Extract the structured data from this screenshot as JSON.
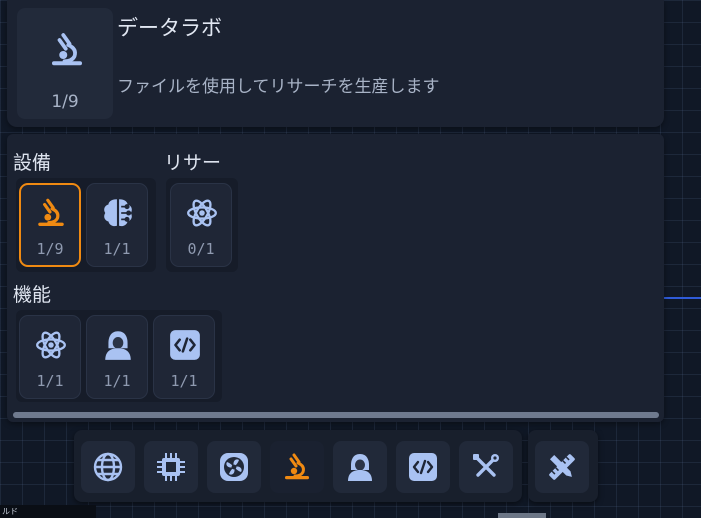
{
  "header": {
    "title": "データラボ",
    "subtitle": "ファイルを使用してリサーチを生産します",
    "icon": "microscope-icon",
    "count": "1/9"
  },
  "sections": {
    "equipment": {
      "label": "設備",
      "slots": [
        {
          "icon": "microscope-icon",
          "count": "1/9",
          "selected": true
        },
        {
          "icon": "brain-circuit-icon",
          "count": "1/1",
          "selected": false
        }
      ]
    },
    "research": {
      "label": "リサー",
      "slots": [
        {
          "icon": "atom-icon",
          "count": "0/1",
          "selected": false
        }
      ]
    },
    "features": {
      "label": "機能",
      "slots": [
        {
          "icon": "atom-icon",
          "count": "1/1"
        },
        {
          "icon": "hooded-user-icon",
          "count": "1/1"
        },
        {
          "icon": "code-icon",
          "count": "1/1"
        }
      ]
    }
  },
  "progress": {
    "fraction": 1.0
  },
  "toolbar": {
    "items": [
      {
        "icon": "globe-icon",
        "active": false
      },
      {
        "icon": "cpu-chip-icon",
        "active": false
      },
      {
        "icon": "fan-icon",
        "active": false
      },
      {
        "icon": "microscope-icon",
        "active": true
      },
      {
        "icon": "hooded-user-icon",
        "active": false
      },
      {
        "icon": "code-icon",
        "active": false
      },
      {
        "icon": "tools-icon",
        "active": false
      }
    ],
    "extra": {
      "icon": "ruler-pencil-icon"
    }
  },
  "footer": {
    "label": "ルド"
  },
  "colors": {
    "accent": "#f08a12",
    "icon": "#a9c2f2",
    "panel": "#1b2231",
    "background": "#101826"
  }
}
